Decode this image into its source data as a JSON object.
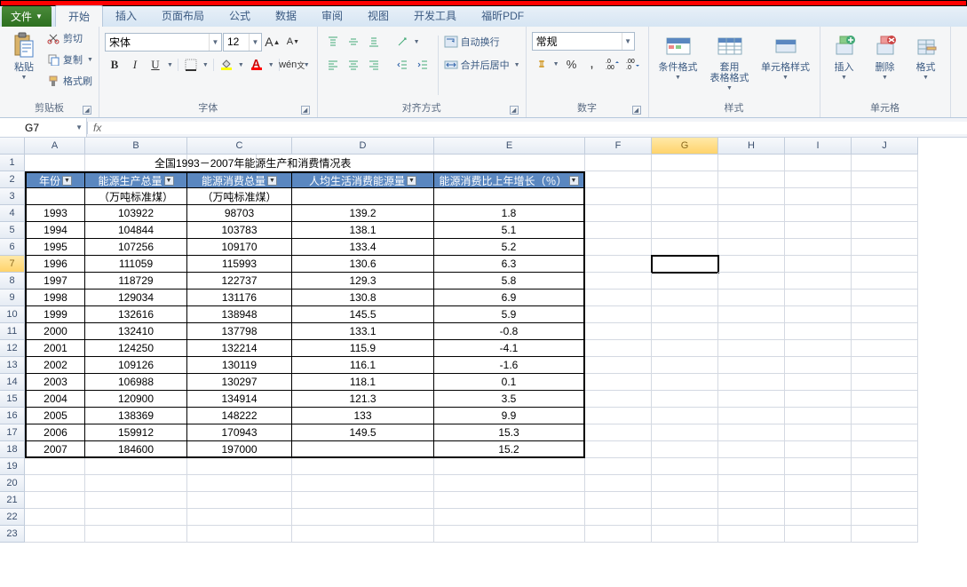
{
  "tabs": {
    "file": "文件",
    "items": [
      "开始",
      "插入",
      "页面布局",
      "公式",
      "数据",
      "审阅",
      "视图",
      "开发工具",
      "福昕PDF"
    ],
    "active": "开始"
  },
  "ribbon": {
    "clipboard": {
      "label": "剪贴板",
      "paste": "粘贴",
      "cut": "剪切",
      "copy": "复制",
      "painter": "格式刷"
    },
    "font": {
      "label": "字体",
      "name": "宋体",
      "size": "12",
      "grow": "A",
      "shrink": "A",
      "bold": "B",
      "italic": "I",
      "under": "U"
    },
    "align": {
      "label": "对齐方式",
      "wrap": "自动换行",
      "merge": "合并后居中"
    },
    "number": {
      "label": "数字",
      "format": "常规",
      "percent": "%",
      "comma": ","
    },
    "styles": {
      "label": "样式",
      "cond": "条件格式",
      "table": "套用\n表格格式",
      "cellstyle": "单元格样式"
    },
    "cells": {
      "label": "单元格",
      "insert": "插入",
      "delete": "删除",
      "format": "格式"
    }
  },
  "namebox": "G7",
  "formula": "",
  "cols": [
    "A",
    "B",
    "C",
    "D",
    "E",
    "F",
    "G",
    "H",
    "I",
    "J"
  ],
  "selectedCol": "G",
  "selectedRow": 7,
  "title": "全国1993－2007年能源生产和消费情况表",
  "headers": [
    "年份",
    "能源生产总量",
    "能源消费总量",
    "人均生活消费能源量",
    "能源消费比上年增长（％）"
  ],
  "subheaders": [
    "",
    "（万吨标准煤）",
    "（万吨标准煤）",
    "",
    ""
  ],
  "rows": [
    [
      "1993",
      "103922",
      "98703",
      "139.2",
      "1.8"
    ],
    [
      "1994",
      "104844",
      "103783",
      "138.1",
      "5.1"
    ],
    [
      "1995",
      "107256",
      "109170",
      "133.4",
      "5.2"
    ],
    [
      "1996",
      "111059",
      "115993",
      "130.6",
      "6.3"
    ],
    [
      "1997",
      "118729",
      "122737",
      "129.3",
      "5.8"
    ],
    [
      "1998",
      "129034",
      "131176",
      "130.8",
      "6.9"
    ],
    [
      "1999",
      "132616",
      "138948",
      "145.5",
      "5.9"
    ],
    [
      "2000",
      "132410",
      "137798",
      "133.1",
      "-0.8"
    ],
    [
      "2001",
      "124250",
      "132214",
      "115.9",
      "-4.1"
    ],
    [
      "2002",
      "109126",
      "130119",
      "116.1",
      "-1.6"
    ],
    [
      "2003",
      "106988",
      "130297",
      "118.1",
      "0.1"
    ],
    [
      "2004",
      "120900",
      "134914",
      "121.3",
      "3.5"
    ],
    [
      "2005",
      "138369",
      "148222",
      "133",
      "9.9"
    ],
    [
      "2006",
      "159912",
      "170943",
      "149.5",
      "15.3"
    ],
    [
      "2007",
      "184600",
      "197000",
      "",
      "15.2"
    ]
  ],
  "chart_data": {
    "type": "table",
    "title": "全国1993－2007年能源生产和消费情况表",
    "columns": [
      "年份",
      "能源生产总量(万吨标准煤)",
      "能源消费总量(万吨标准煤)",
      "人均生活消费能源量",
      "能源消费比上年增长(%)"
    ],
    "data": [
      [
        1993,
        103922,
        98703,
        139.2,
        1.8
      ],
      [
        1994,
        104844,
        103783,
        138.1,
        5.1
      ],
      [
        1995,
        107256,
        109170,
        133.4,
        5.2
      ],
      [
        1996,
        111059,
        115993,
        130.6,
        6.3
      ],
      [
        1997,
        118729,
        122737,
        129.3,
        5.8
      ],
      [
        1998,
        129034,
        131176,
        130.8,
        6.9
      ],
      [
        1999,
        132616,
        138948,
        145.5,
        5.9
      ],
      [
        2000,
        132410,
        137798,
        133.1,
        -0.8
      ],
      [
        2001,
        124250,
        132214,
        115.9,
        -4.1
      ],
      [
        2002,
        109126,
        130119,
        116.1,
        -1.6
      ],
      [
        2003,
        106988,
        130297,
        118.1,
        0.1
      ],
      [
        2004,
        120900,
        134914,
        121.3,
        3.5
      ],
      [
        2005,
        138369,
        148222,
        133,
        9.9
      ],
      [
        2006,
        159912,
        170943,
        149.5,
        15.3
      ],
      [
        2007,
        184600,
        197000,
        null,
        15.2
      ]
    ]
  }
}
